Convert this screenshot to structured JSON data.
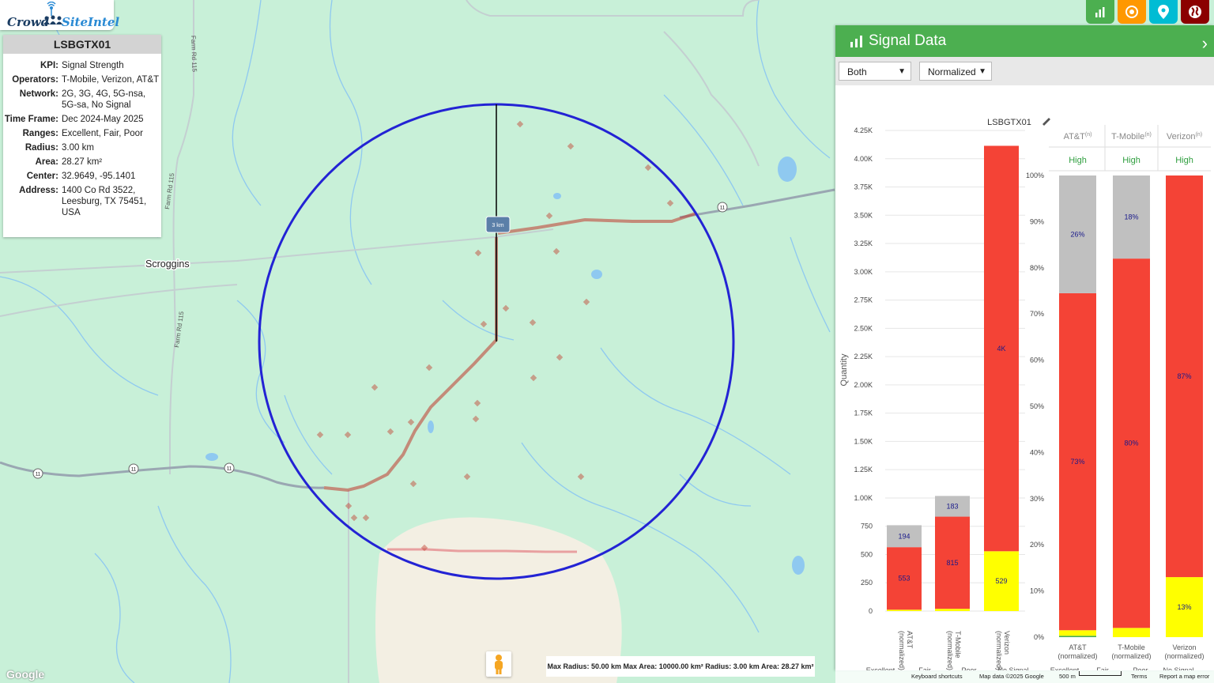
{
  "logo": {
    "crowd": "Crowd",
    "site": "SiteIntel"
  },
  "info": {
    "title": "LSBGTX01",
    "rows": [
      {
        "k": "KPI:",
        "v": "Signal Strength"
      },
      {
        "k": "Operators:",
        "v": "T-Mobile, Verizon, AT&T"
      },
      {
        "k": "Network:",
        "v": "2G, 3G, 4G, 5G-nsa, 5G-sa, No Signal"
      },
      {
        "k": "Time Frame:",
        "v": "Dec 2024-May 2025"
      },
      {
        "k": "Ranges:",
        "v": "Excellent, Fair, Poor"
      },
      {
        "k": "Radius:",
        "v": "3.00 km"
      },
      {
        "k": "Area:",
        "v": "28.27 km²"
      },
      {
        "k": "Center:",
        "v": "32.9649, -95.1401"
      },
      {
        "k": "Address:",
        "v": "1400 Co Rd 3522, Leesburg, TX 75451, USA"
      }
    ]
  },
  "map": {
    "town": "Scroggins",
    "roads": [
      "Farm Rd 115",
      "Farm Rd 115",
      "Farm Rd 115"
    ],
    "route_shield": "11",
    "radius_label": "3 km",
    "footer_info": "Max Radius: 50.00 km  Max Area: 10000.00 km²  Radius: 3.00 km  Area: 28.27 km²",
    "google": "Google",
    "keyboard": "Keyboard shortcuts",
    "mapdata": "Map data ©2025 Google",
    "scale": "500 m",
    "terms": "Terms",
    "report": "Report a map error"
  },
  "top_buttons": [
    {
      "icon": "bar-chart-icon",
      "color": "#4caf50"
    },
    {
      "icon": "target-icon",
      "color": "#ff9800"
    },
    {
      "icon": "location-pin-icon",
      "color": "#00bcd4"
    },
    {
      "icon": "globe-icon",
      "color": "#8b0000"
    }
  ],
  "panel": {
    "title": "Signal Data",
    "select1": "Both",
    "select2": "Normalized",
    "chart_title": "LSBGTX01",
    "columns": [
      {
        "name": "AT&T",
        "sup": "(n)",
        "level": "High"
      },
      {
        "name": "T-Mobile",
        "sup": "(n)",
        "level": "High"
      },
      {
        "name": "Verizon",
        "sup": "(n)",
        "level": "High"
      }
    ],
    "legend": [
      "Excellent",
      "Fair",
      "Poor",
      "No Signal"
    ]
  },
  "chart_data": [
    {
      "type": "bar",
      "stacked": true,
      "title": "LSBGTX01",
      "ylabel": "Quantity",
      "ylim": [
        0,
        4250
      ],
      "yticks": [
        "0",
        "250",
        "500",
        "750",
        "1.00K",
        "1.25K",
        "1.50K",
        "1.75K",
        "2.00K",
        "2.25K",
        "2.50K",
        "2.75K",
        "3.00K",
        "3.25K",
        "3.50K",
        "3.75K",
        "4.00K",
        "4.25K"
      ],
      "categories": [
        "AT&T (normalized)",
        "T-Mobile (normalized)",
        "Verizon (normalized)"
      ],
      "series": [
        {
          "name": "Excellent",
          "color": "#4caf50",
          "values": [
            0,
            0,
            0
          ]
        },
        {
          "name": "Fair",
          "color": "#ffff00",
          "values": [
            12,
            20,
            529
          ]
        },
        {
          "name": "Poor",
          "color": "#f44336",
          "values": [
            553,
            815,
            3585
          ]
        },
        {
          "name": "No Signal",
          "color": "#c0c0c0",
          "values": [
            194,
            183,
            0
          ]
        }
      ],
      "data_labels": [
        {
          "cat": 0,
          "series": "Poor",
          "text": "553"
        },
        {
          "cat": 0,
          "series": "No Signal",
          "text": "194"
        },
        {
          "cat": 1,
          "series": "Poor",
          "text": "815"
        },
        {
          "cat": 1,
          "series": "No Signal",
          "text": "183"
        },
        {
          "cat": 2,
          "series": "Fair",
          "text": "529"
        },
        {
          "cat": 2,
          "series": "Poor",
          "text": "4K"
        }
      ],
      "legend": "bottom"
    },
    {
      "type": "bar",
      "stacked": true,
      "ylim": [
        0,
        100
      ],
      "yticks": [
        "0%",
        "10%",
        "20%",
        "30%",
        "40%",
        "50%",
        "60%",
        "70%",
        "80%",
        "90%",
        "100%"
      ],
      "categories": [
        "AT&T (normalized)",
        "T-Mobile (normalized)",
        "Verizon (normalized)"
      ],
      "series": [
        {
          "name": "Excellent",
          "color": "#4caf50",
          "values": [
            0.3,
            0,
            0
          ]
        },
        {
          "name": "Fair",
          "color": "#ffff00",
          "values": [
            1.2,
            2,
            13
          ]
        },
        {
          "name": "Poor",
          "color": "#f44336",
          "values": [
            73,
            80,
            87
          ]
        },
        {
          "name": "No Signal",
          "color": "#c0c0c0",
          "values": [
            25.5,
            18,
            0
          ]
        }
      ],
      "data_labels": [
        {
          "cat": 0,
          "series": "Poor",
          "text": "73%"
        },
        {
          "cat": 0,
          "series": "No Signal",
          "text": "26%"
        },
        {
          "cat": 1,
          "series": "Poor",
          "text": "80%"
        },
        {
          "cat": 1,
          "series": "No Signal",
          "text": "18%"
        },
        {
          "cat": 2,
          "series": "Fair",
          "text": "13%"
        },
        {
          "cat": 2,
          "series": "Poor",
          "text": "87%"
        }
      ],
      "legend": "bottom"
    }
  ]
}
